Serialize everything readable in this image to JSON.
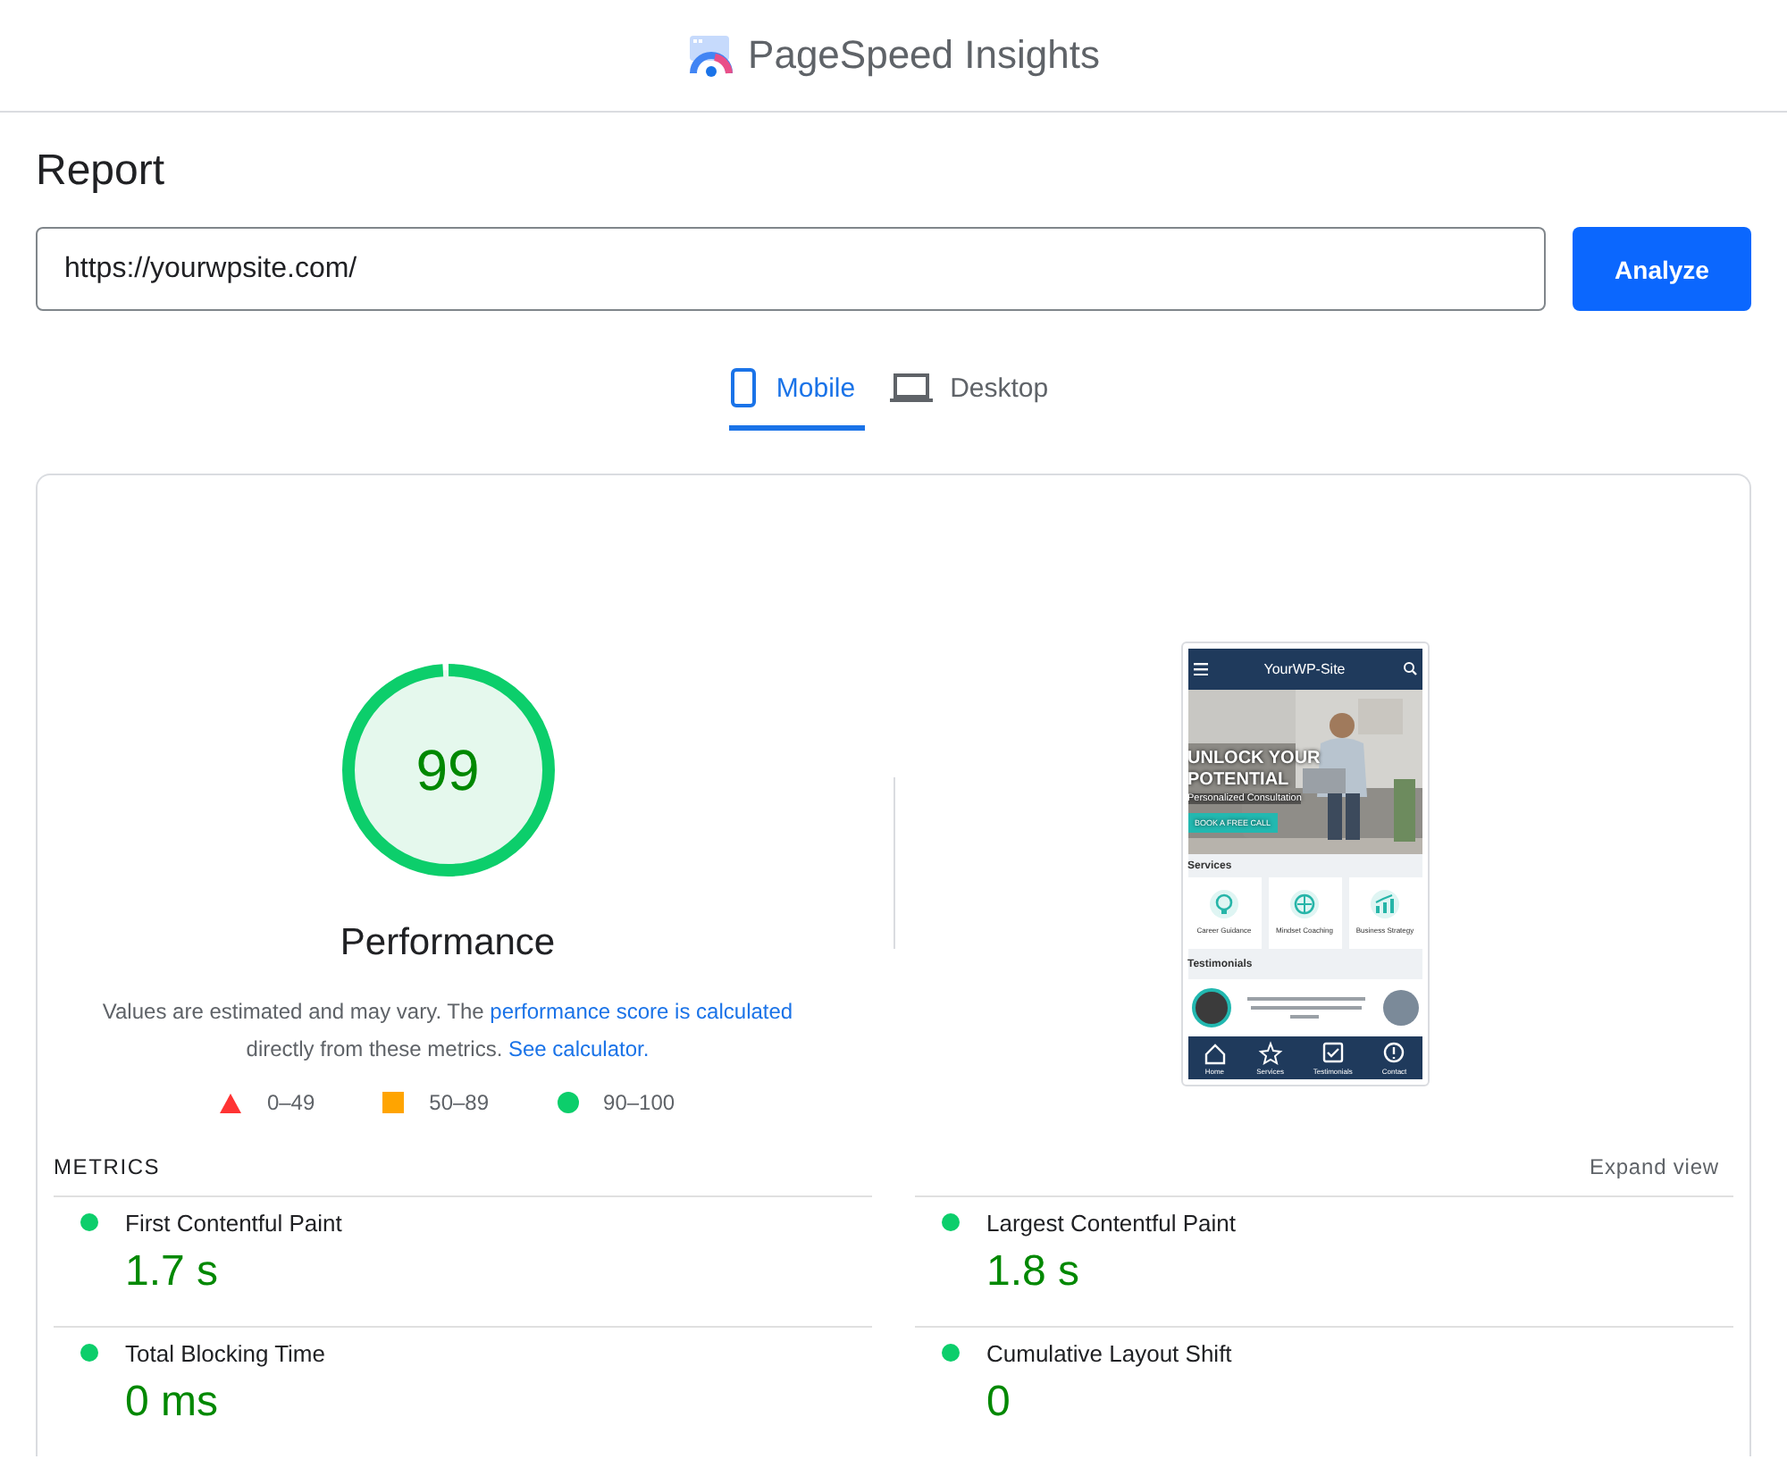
{
  "header": {
    "title": "PageSpeed Insights"
  },
  "report": {
    "title": "Report",
    "url_field": {
      "value": "https://yourwpsite.com/"
    },
    "analyze_button": "Analyze"
  },
  "tabs": [
    {
      "label": "Mobile",
      "kind": "phone",
      "selected": true
    },
    {
      "label": "Desktop",
      "kind": "laptop",
      "selected": false
    }
  ],
  "summary": {
    "score": "99",
    "level": 0.99,
    "category": "Performance",
    "note": {
      "text": "Values are estimated and may vary. The ",
      "link": "performance score is calculated",
      "text_2": " directly from these metrics. ",
      "link_2": "See calculator."
    },
    "legend": [
      {
        "kind": "triangle",
        "range": "0–49",
        "color": "#ff3333"
      },
      {
        "kind": "square",
        "range": "50–89",
        "color": "#ffa400"
      },
      {
        "kind": "circle",
        "range": "90–100",
        "color": "#0cce6b"
      }
    ]
  },
  "screenshot": {
    "site_title": "YourWP-Site",
    "headline": "UNLOCK YOUR POTENTIAL",
    "subline": "Personalized Consultation",
    "cta": "BOOK A FREE CALL",
    "services_heading": "Services",
    "services": [
      {
        "label": "Career Guidance",
        "kind": "bulb"
      },
      {
        "label": "Mindset Coaching",
        "kind": "globe"
      },
      {
        "label": "Business Strategy",
        "kind": "chart"
      }
    ],
    "testimonials_heading": "Testimonials",
    "nav": [
      {
        "label": "Home",
        "kind": "home"
      },
      {
        "label": "Services",
        "kind": "star"
      },
      {
        "label": "Testimonials",
        "kind": "check"
      },
      {
        "label": "Contact",
        "kind": "info"
      }
    ]
  },
  "metrics": {
    "heading": "METRICS",
    "expand": "Expand view",
    "items": [
      {
        "name": "First Contentful Paint",
        "value": "1.7 s",
        "color": "#0cce6b"
      },
      {
        "name": "Largest Contentful Paint",
        "value": "1.8 s",
        "color": "#0cce6b"
      },
      {
        "name": "Total Blocking Time",
        "value": "0 ms",
        "color": "#0cce6b"
      },
      {
        "name": "Cumulative Layout Shift",
        "value": "0",
        "color": "#0cce6b"
      }
    ]
  }
}
